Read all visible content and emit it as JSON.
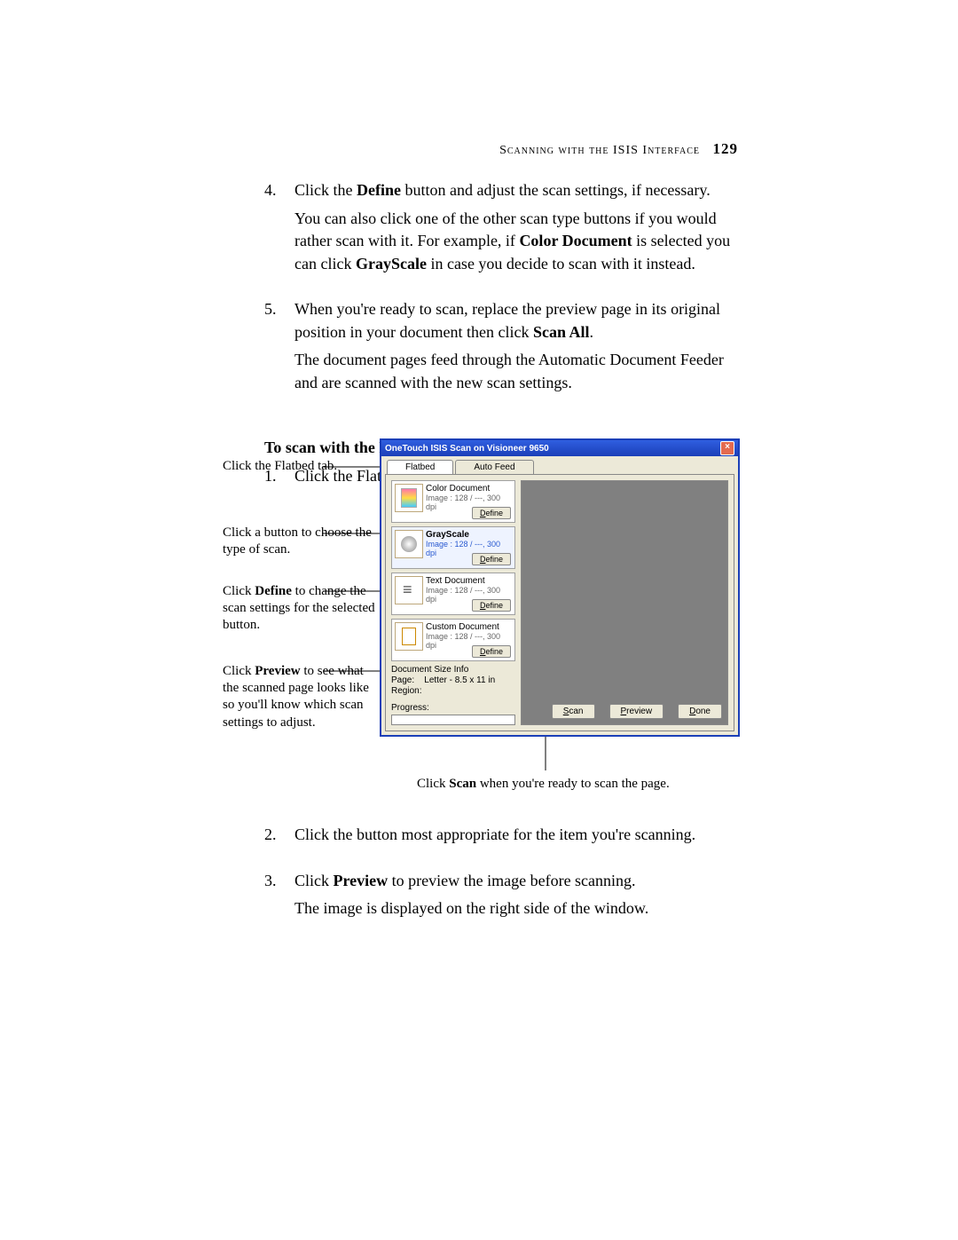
{
  "header": {
    "section": "Scanning with the ISIS Interface",
    "page_number": "129"
  },
  "steps_top": [
    {
      "num": "4.",
      "parts": [
        {
          "t": "Click the "
        },
        {
          "b": "Define"
        },
        {
          "t": " button and adjust the scan settings, if necessary."
        }
      ],
      "paras": [
        [
          {
            "t": "You can also click one of the other scan type buttons if you would rather scan with it. For example, if "
          },
          {
            "b": "Color Document"
          },
          {
            "t": " is selected you can click "
          },
          {
            "b": "GrayScale"
          },
          {
            "t": " in case you decide to scan with it instead."
          }
        ]
      ]
    },
    {
      "num": "5.",
      "parts": [
        {
          "t": "When you're ready to scan, replace the preview page in its original position in your document then click "
        },
        {
          "b": "Scan All"
        },
        {
          "t": "."
        }
      ],
      "paras": [
        [
          {
            "t": "The document pages feed through the Automatic Document Feeder and are scanned with the new scan settings."
          }
        ]
      ]
    }
  ],
  "subhead": "To scan with the Flatbed:",
  "steps_mid": [
    {
      "num": "1.",
      "parts": [
        {
          "t": "Click the Flatbed tab at the top of the window."
        }
      ]
    }
  ],
  "steps_bottom": [
    {
      "num": "2.",
      "parts": [
        {
          "t": "Click the button most appropriate for the item you're scanning."
        }
      ]
    },
    {
      "num": "3.",
      "parts": [
        {
          "t": "Click "
        },
        {
          "b": "Preview"
        },
        {
          "t": " to preview the image before scanning."
        }
      ],
      "paras": [
        [
          {
            "t": "The image is displayed on the right side of the window."
          }
        ]
      ]
    }
  ],
  "callouts": {
    "flatbed": "Click the Flatbed tab.",
    "button_choose": "Click a button to choose the type of scan.",
    "define_parts": [
      {
        "t": "Click "
      },
      {
        "b": "Define"
      },
      {
        "t": " to change the scan settings for the selected button."
      }
    ],
    "preview_parts": [
      {
        "t": "Click "
      },
      {
        "b": "Preview"
      },
      {
        "t": " to see what the scanned page looks like so you'll know which scan settings to adjust."
      }
    ]
  },
  "caption_scan_parts": [
    {
      "t": "Click "
    },
    {
      "b": "Scan"
    },
    {
      "t": " when you're ready to scan the page."
    }
  ],
  "dialog": {
    "title": "OneTouch ISIS Scan on Visioneer 9650",
    "tabs": {
      "flatbed": "Flatbed",
      "autofeed": "Auto Feed"
    },
    "options": [
      {
        "title": "Color Document",
        "detail": "Image : 128 / ---, 300 dpi",
        "bold": false,
        "blue": false,
        "icon": "color",
        "selected": false
      },
      {
        "title": "GrayScale",
        "detail": "Image : 128 / ---, 300 dpi",
        "bold": true,
        "blue": true,
        "icon": "gray",
        "selected": true
      },
      {
        "title": "Text Document",
        "detail": "Image : 128 / ---, 300 dpi",
        "bold": false,
        "blue": false,
        "icon": "text",
        "selected": false
      },
      {
        "title": "Custom Document",
        "detail": "Image : 128 / ---, 300 dpi",
        "bold": false,
        "blue": false,
        "icon": "custom",
        "selected": false
      }
    ],
    "define_label": "Define",
    "dsi": {
      "heading": "Document Size Info",
      "page_label": "Page:",
      "page_value": "Letter - 8.5 x 11 in",
      "region_label": "Region:"
    },
    "progress_label": "Progress:",
    "buttons": {
      "scan": "Scan",
      "preview": "Preview",
      "done": "Done"
    }
  }
}
